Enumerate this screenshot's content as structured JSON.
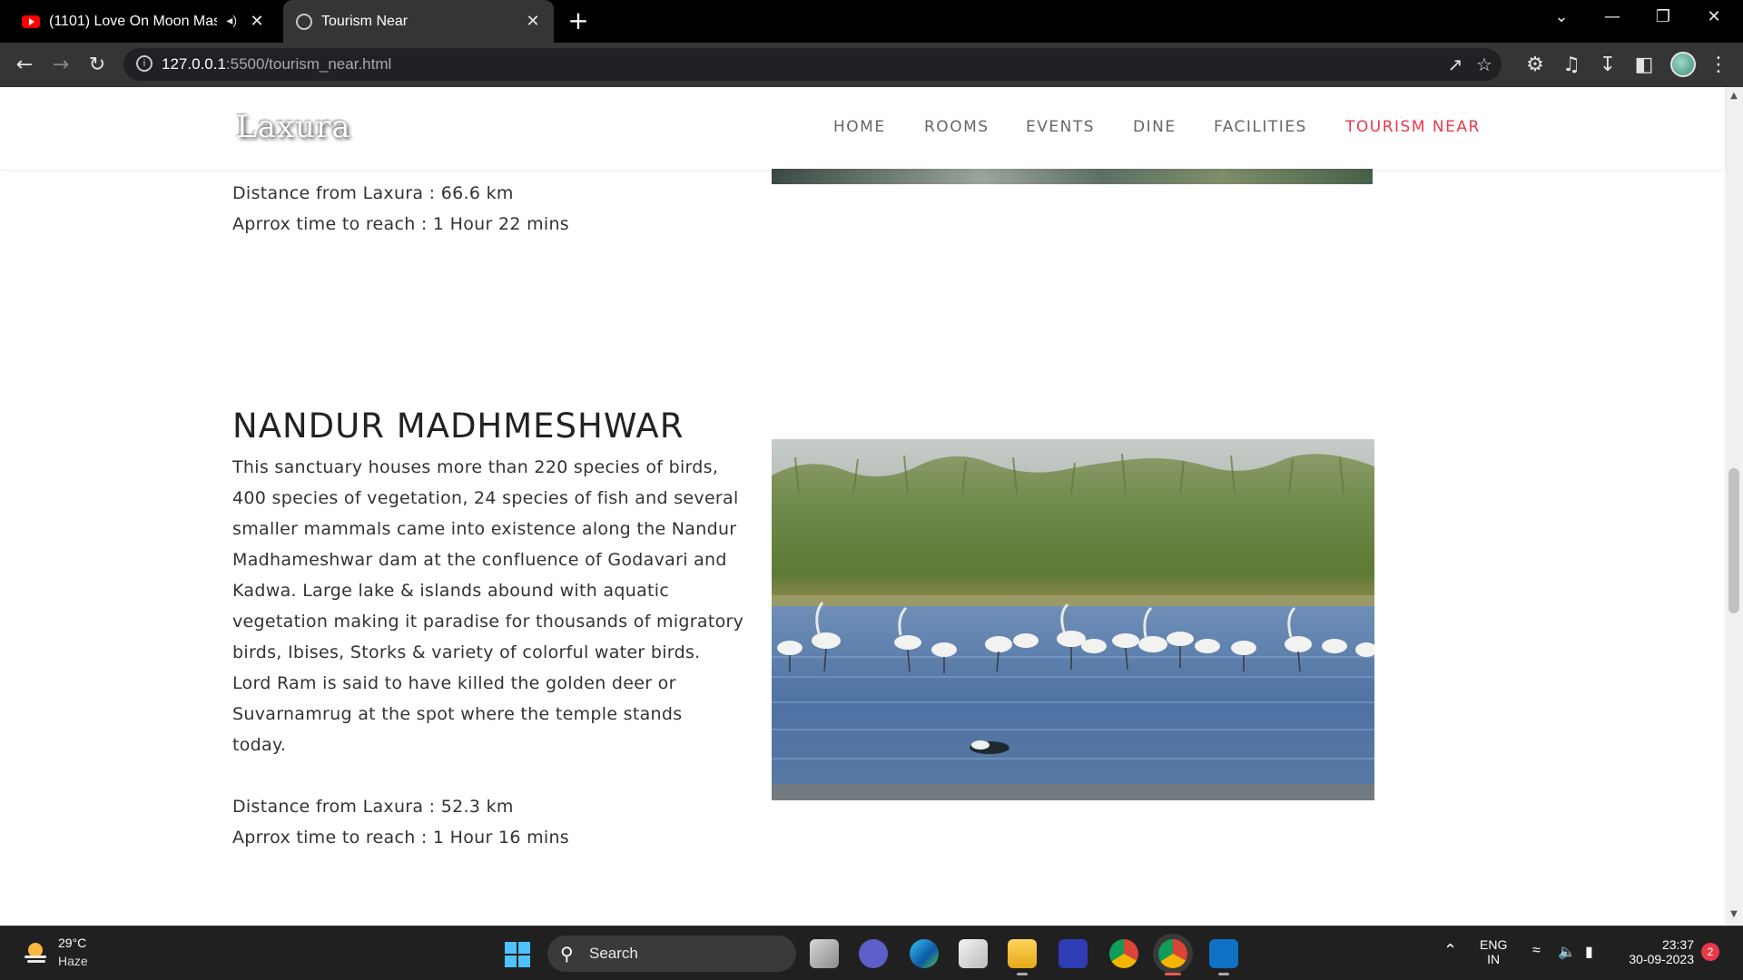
{
  "browser": {
    "tabs": [
      {
        "title": "(1101) Love On Moon Mash",
        "icon": "youtube-icon",
        "audio": true
      },
      {
        "title": "Tourism Near",
        "icon": "globe-icon",
        "active": true
      }
    ],
    "url_host": "127.0.0.1",
    "url_rest": ":5500/tourism_near.html"
  },
  "site": {
    "logo": "Laxura",
    "nav": [
      "HOME",
      "ROOMS",
      "EVENTS",
      "DINE",
      "FACILITIES",
      "TOURISM NEAR"
    ],
    "active_nav": "TOURISM NEAR",
    "accent_color": "#e8394a"
  },
  "previous_place": {
    "distance": "Distance from Laxura : 66.6 km",
    "time": "Aprrox time to reach : 1 Hour 22 mins"
  },
  "place": {
    "name": "NANDUR MADHMESHWAR",
    "description_lines": [
      "This sanctuary houses more than 220 species of birds,",
      "400 species of vegetation, 24 species of fish and several",
      "smaller mammals came into existence along the Nandur",
      "Madhameshwar dam at the confluence of Godavari and",
      "Kadwa. Large lake & islands abound with aquatic",
      "vegetation making it paradise for thousands of migratory",
      "birds, Ibises, Storks & variety of colorful water birds.",
      "Lord Ram is said to have killed the golden deer or",
      "Suvarnamrug at the spot where the temple stands",
      "today."
    ],
    "distance": "Distance from Laxura : 52.3 km",
    "time": "Aprrox time to reach : 1 Hour 16 mins"
  },
  "taskbar": {
    "temperature": "29°C",
    "weather": "Haze",
    "search_label": "Search",
    "lang_line1": "ENG",
    "lang_line2": "IN",
    "time": "23:37",
    "date": "30-09-2023",
    "notification_count": "2"
  }
}
